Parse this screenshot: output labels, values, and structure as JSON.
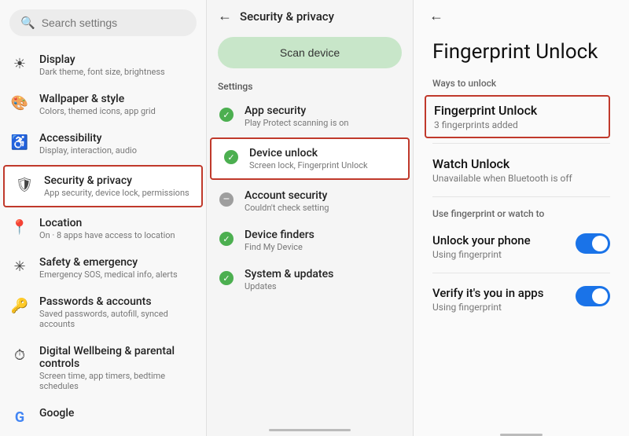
{
  "search": {
    "placeholder": "Search settings",
    "icon": "🔍"
  },
  "left": {
    "items": [
      {
        "id": "display",
        "icon": "☀",
        "title": "Display",
        "subtitle": "Dark theme, font size, brightness"
      },
      {
        "id": "wallpaper",
        "icon": "🎨",
        "title": "Wallpaper & style",
        "subtitle": "Colors, themed icons, app grid"
      },
      {
        "id": "accessibility",
        "icon": "♿",
        "title": "Accessibility",
        "subtitle": "Display, interaction, audio"
      },
      {
        "id": "security",
        "icon": "🛡",
        "title": "Security & privacy",
        "subtitle": "App security, device lock, permissions",
        "active": true
      },
      {
        "id": "location",
        "icon": "📍",
        "title": "Location",
        "subtitle": "On · 8 apps have access to location"
      },
      {
        "id": "safety",
        "icon": "✳",
        "title": "Safety & emergency",
        "subtitle": "Emergency SOS, medical info, alerts"
      },
      {
        "id": "passwords",
        "icon": "🔑",
        "title": "Passwords & accounts",
        "subtitle": "Saved passwords, autofill, synced accounts"
      },
      {
        "id": "wellbeing",
        "icon": "⏱",
        "title": "Digital Wellbeing & parental controls",
        "subtitle": "Screen time, app timers, bedtime schedules"
      },
      {
        "id": "google",
        "icon": "G",
        "title": "Google",
        "subtitle": ""
      }
    ]
  },
  "middle": {
    "back_arrow": "←",
    "title": "Security & privacy",
    "scan_button": "Scan device",
    "section_label": "Settings",
    "items": [
      {
        "id": "app-security",
        "status": "check",
        "title": "App security",
        "subtitle": "Play Protect scanning is on"
      },
      {
        "id": "device-unlock",
        "status": "check",
        "title": "Device unlock",
        "subtitle": "Screen lock, Fingerprint Unlock",
        "active": true
      },
      {
        "id": "account-security",
        "status": "dash",
        "title": "Account security",
        "subtitle": "Couldn't check setting"
      },
      {
        "id": "device-finders",
        "status": "check",
        "title": "Device finders",
        "subtitle": "Find My Device"
      },
      {
        "id": "system-updates",
        "status": "check",
        "title": "System & updates",
        "subtitle": "Updates"
      }
    ]
  },
  "right": {
    "back_arrow": "←",
    "page_title": "Fingerprint Unlock",
    "ways_to_unlock_label": "Ways to unlock",
    "fingerprint_unlock": {
      "title": "Fingerprint Unlock",
      "subtitle": "3 fingerprints added",
      "highlighted": true
    },
    "watch_unlock": {
      "title": "Watch Unlock",
      "subtitle": "Unavailable when Bluetooth is off"
    },
    "use_fp_label": "Use fingerprint or watch to",
    "toggles": [
      {
        "id": "unlock-phone",
        "title": "Unlock your phone",
        "subtitle": "Using fingerprint",
        "enabled": true
      },
      {
        "id": "verify-apps",
        "title": "Verify it's you in apps",
        "subtitle": "Using fingerprint",
        "enabled": true
      }
    ]
  }
}
